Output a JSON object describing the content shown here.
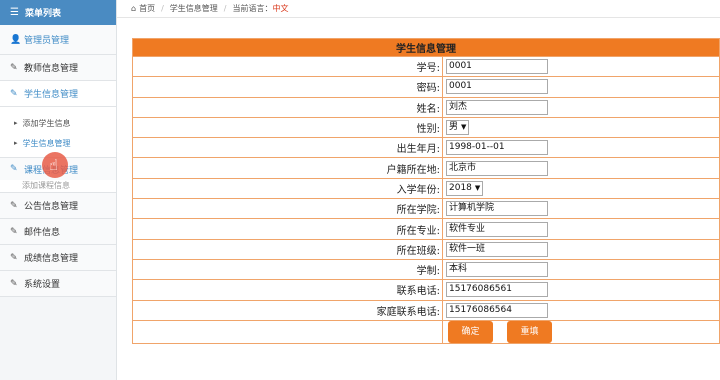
{
  "sidebar": {
    "header": "菜单列表",
    "items": [
      {
        "label": "管理员管理",
        "icon": "user-icon"
      },
      {
        "label": "教师信息管理",
        "icon": "edit-icon"
      },
      {
        "label": "学生信息管理",
        "icon": "edit-icon"
      },
      {
        "label": "课程信息管理",
        "icon": "edit-icon"
      },
      {
        "label": "公告信息管理",
        "icon": "edit-icon"
      },
      {
        "label": "邮件信息",
        "icon": "edit-icon"
      },
      {
        "label": "成绩信息管理",
        "icon": "edit-icon"
      },
      {
        "label": "系统设置",
        "icon": "edit-icon"
      }
    ],
    "student_sub": [
      "添加学生信息",
      "学生信息管理"
    ],
    "course_sub_cut": "添加课程信息"
  },
  "breadcrumb": {
    "home": "首页",
    "page": "学生信息管理",
    "lang_label": "当前语言：",
    "lang_value": "中文"
  },
  "form": {
    "title": "学生信息管理",
    "fields": {
      "student_id": {
        "label": "学号:",
        "value": "0001"
      },
      "password": {
        "label": "密码:",
        "value": "0001"
      },
      "name": {
        "label": "姓名:",
        "value": "刘杰"
      },
      "gender": {
        "label": "性别:",
        "value": "男"
      },
      "birth": {
        "label": "出生年月:",
        "value": "1998-01--01"
      },
      "hometown": {
        "label": "户籍所在地:",
        "value": "北京市"
      },
      "enroll_year": {
        "label": "入学年份:",
        "value": "2018"
      },
      "college": {
        "label": "所在学院:",
        "value": "计算机学院"
      },
      "major": {
        "label": "所在专业:",
        "value": "软件专业"
      },
      "class": {
        "label": "所在班级:",
        "value": "软件一班"
      },
      "system": {
        "label": "学制:",
        "value": "本科"
      },
      "phone": {
        "label": "联系电话:",
        "value": "15176086561"
      },
      "family_phone": {
        "label": "家庭联系电话:",
        "value": "15176086564"
      }
    },
    "confirm_label": "确定",
    "reset_label": "重填"
  }
}
